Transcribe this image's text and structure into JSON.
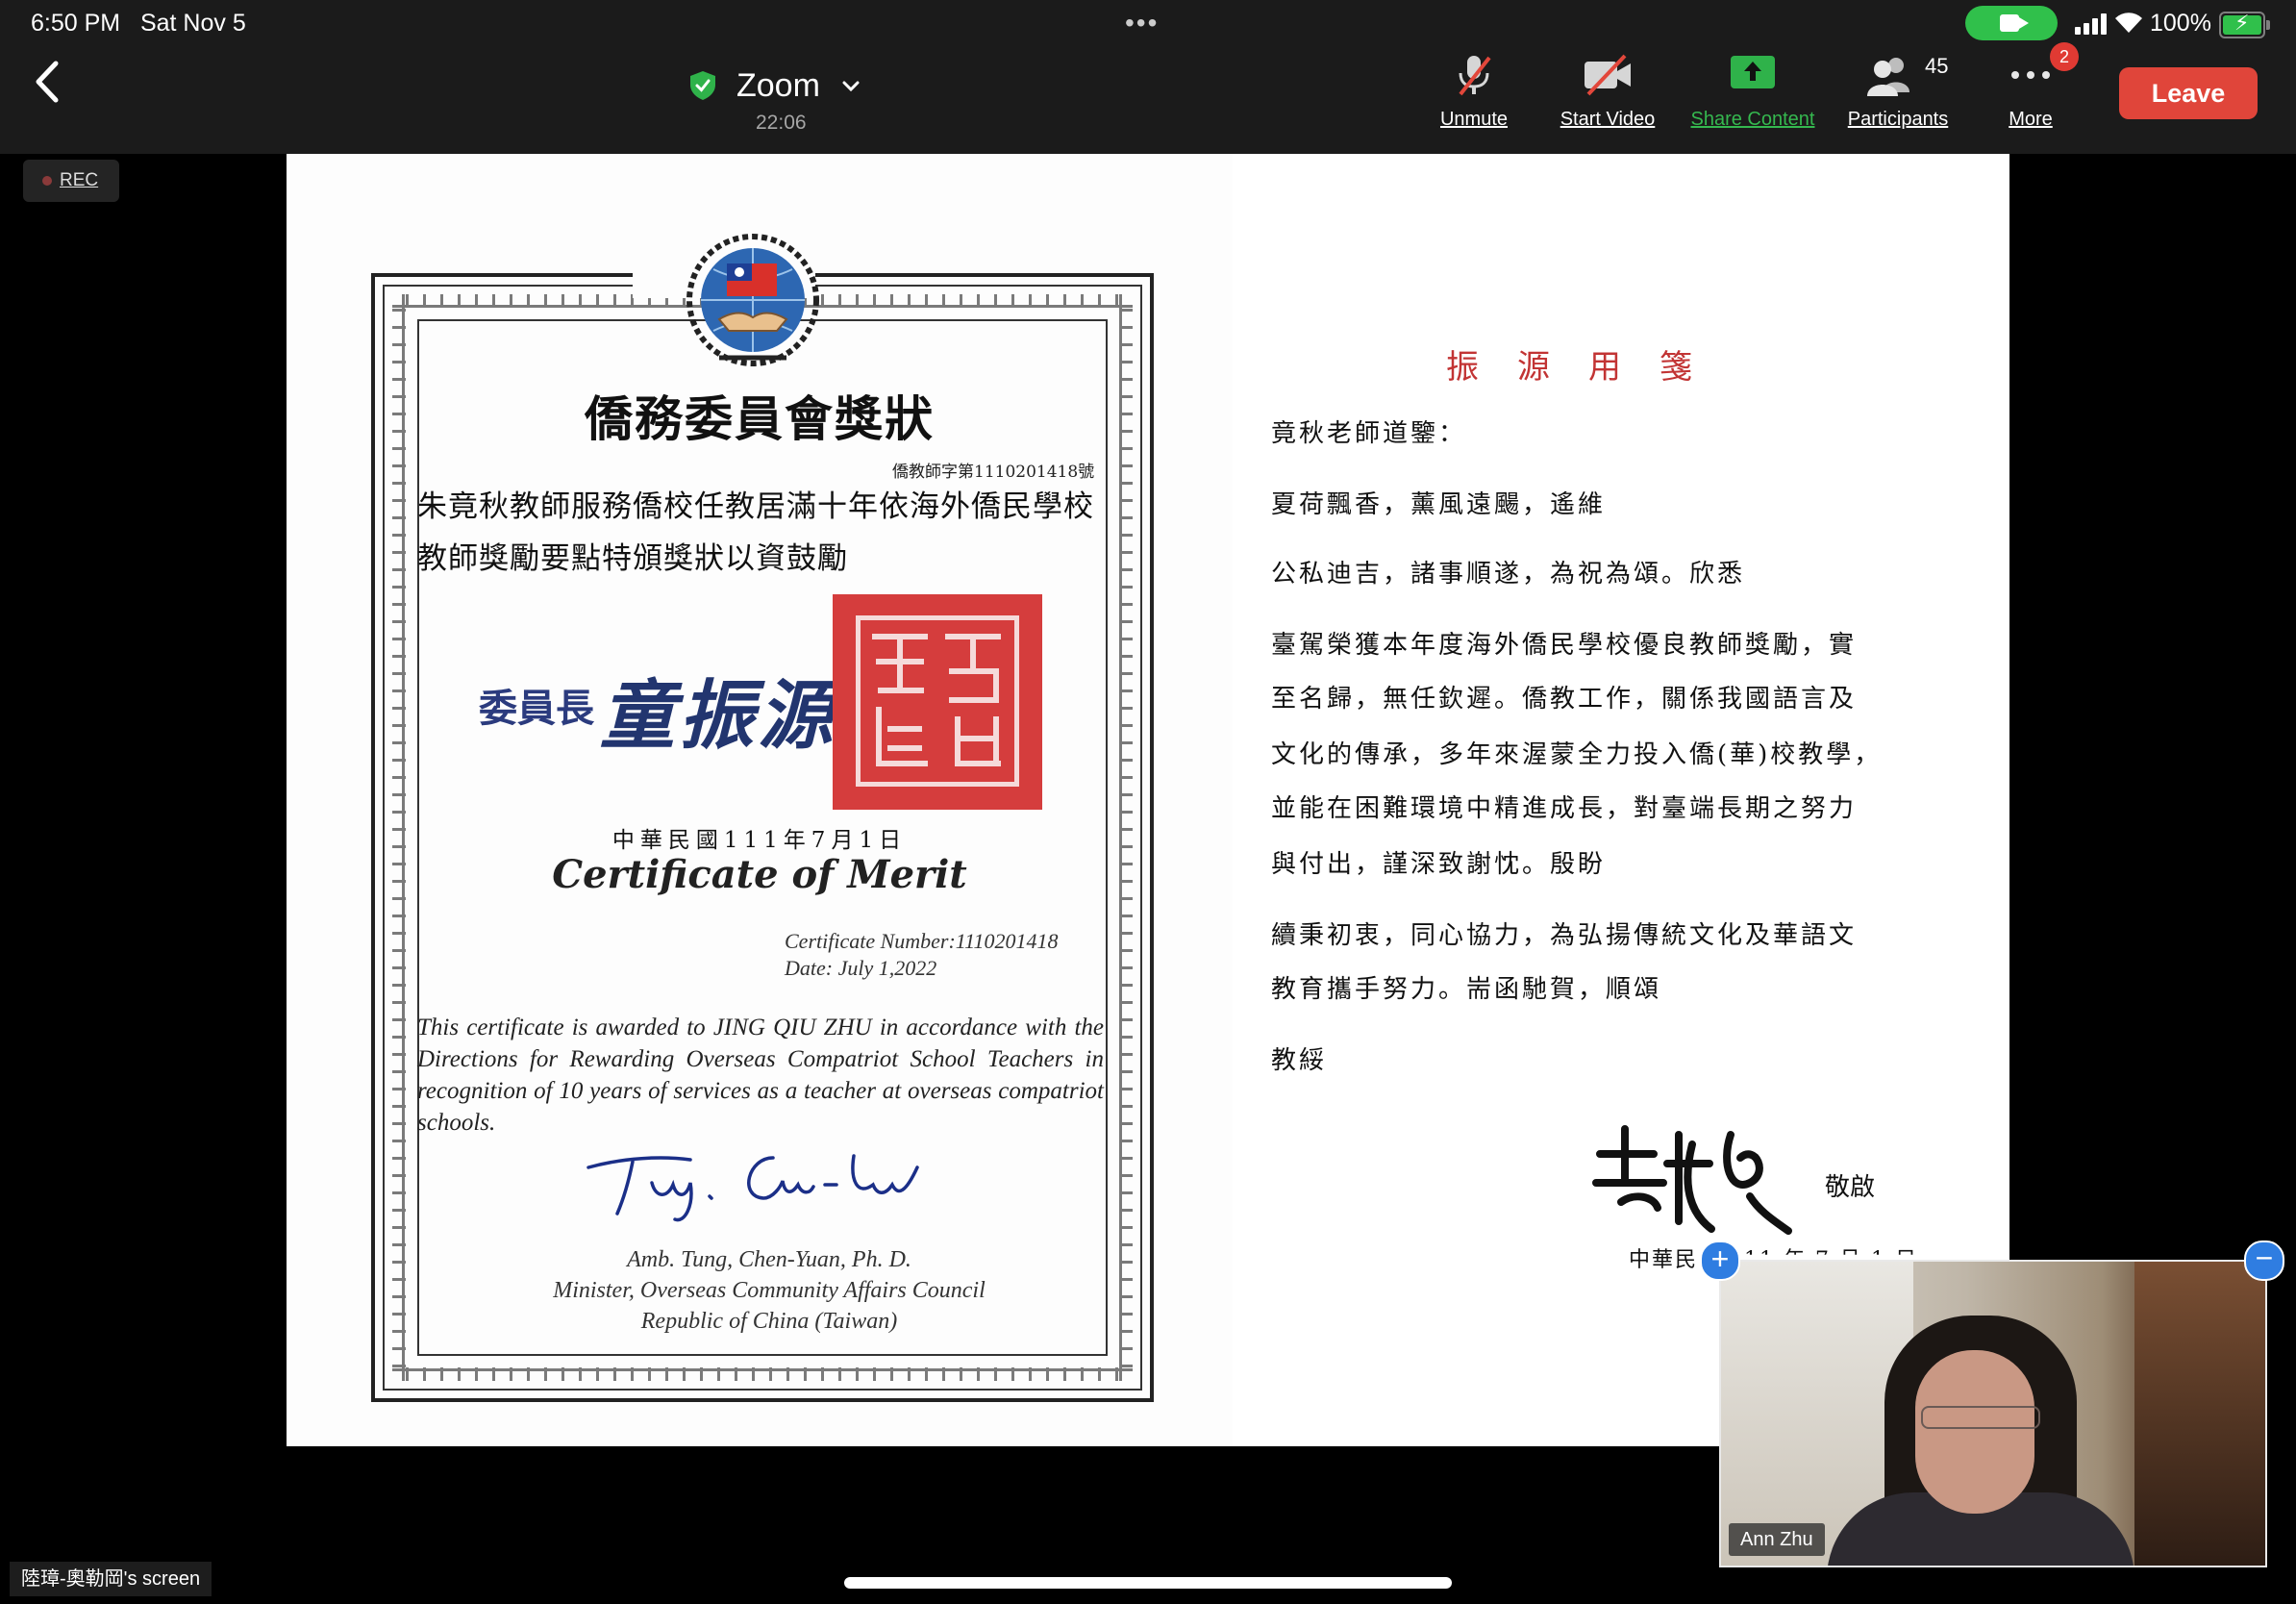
{
  "status_bar": {
    "time": "6:50 PM",
    "date": "Sat Nov 5",
    "dots": "•••",
    "battery": "100%",
    "accent_green": "#30c04b"
  },
  "header": {
    "title": "Zoom",
    "timer": "22:06",
    "leave_label": "Leave"
  },
  "toolbar": {
    "unmute": "Unmute",
    "start_video": "Start Video",
    "share_content": "Share Content",
    "participants": "Participants",
    "participants_count": "45",
    "more": "More",
    "more_badge": "2"
  },
  "recording": {
    "label": "REC"
  },
  "certificate": {
    "cn_title": "僑務委員會獎狀",
    "cn_number": "僑教師字第1110201418號",
    "cn_body": "朱竟秋教師服務僑校任教居滿十年依海外僑民學校教師獎勵要點特頒獎狀以資鼓勵",
    "chair_label": "委員長",
    "chair_signature": "童振源",
    "cn_date": "中華民國111年7月1日",
    "en_title": "Certificate of Merit",
    "number": "Certificate Number:1110201418",
    "date": "Date: July 1,2022",
    "en_body": "This certificate is awarded to JING QIU ZHU in accordance with the Directions for Rewarding Overseas Compatriot School Teachers in recognition of 10 years of services as a teacher at overseas compatriot schools.",
    "amb_line1": "Amb. Tung, Chen-Yuan, Ph. D.",
    "amb_line2": "Minister, Overseas Community Affairs Council",
    "amb_line3": "Republic of China (Taiwan)"
  },
  "letter": {
    "heading": "振源用箋",
    "salutation": "竟秋老師道鑒：",
    "p1": "夏荷飄香，薰風遠颺，遙維",
    "p2": "公私迪吉，諸事順遂，為祝為頌。欣悉",
    "p3a": "臺駕榮獲本年度海外僑民學校優良教師獎勵，實",
    "p3b": "至名歸，無任欽遲。僑教工作，關係我國語言及",
    "p3c": "文化的傳承，多年來渥蒙全力投入僑(華)校教學，",
    "p3d": "並能在困難環境中精進成長，對臺端長期之努力",
    "p3e": "與付出，謹深致謝忱。殷盼",
    "p4a": "續秉初衷，同心協力，為弘揚傳統文化及華語文",
    "p4b": "教育攜手努力。耑函馳賀，順頌",
    "closing": "教綏",
    "sign_tail": "敬啟",
    "date_visible": "中華民",
    "date_rest": "11 年 7 月 1 日"
  },
  "video": {
    "participant_name": "Ann Zhu"
  },
  "screen_share_label": "陸璋-奧勒岡's screen"
}
